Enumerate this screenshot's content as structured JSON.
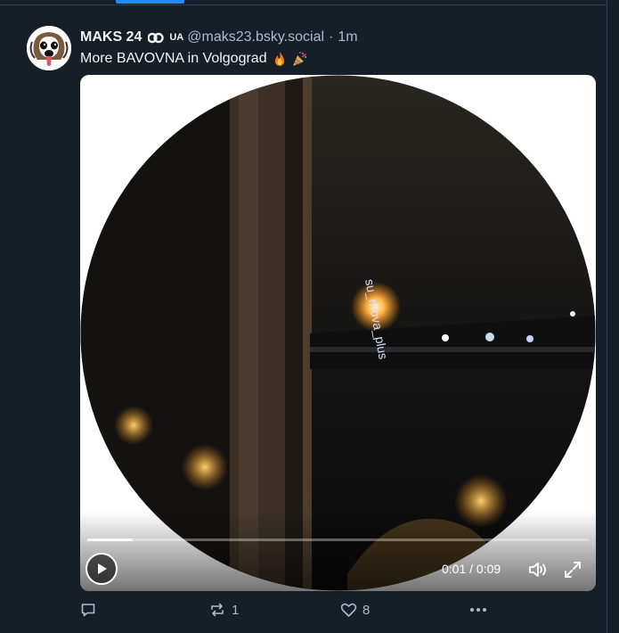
{
  "post": {
    "display_name": "MAKS 24",
    "flag_label": "UA",
    "handle": "@maks23.bsky.social",
    "separator": "·",
    "time": "1m",
    "text": "More BAVOVNA in Volgograd",
    "emojis": [
      "fire-emoji",
      "party-popper-emoji"
    ]
  },
  "video": {
    "current_time": "0:01",
    "duration": "0:09",
    "time_separator": " / ",
    "progress": 0.09,
    "watermark": "su_rnova_plus"
  },
  "actions": {
    "reply_count": "",
    "repost_count": "1",
    "like_count": "8"
  },
  "colors": {
    "background": "#161e27",
    "accent": "#208bfe",
    "muted_text": "#aebbc9"
  }
}
